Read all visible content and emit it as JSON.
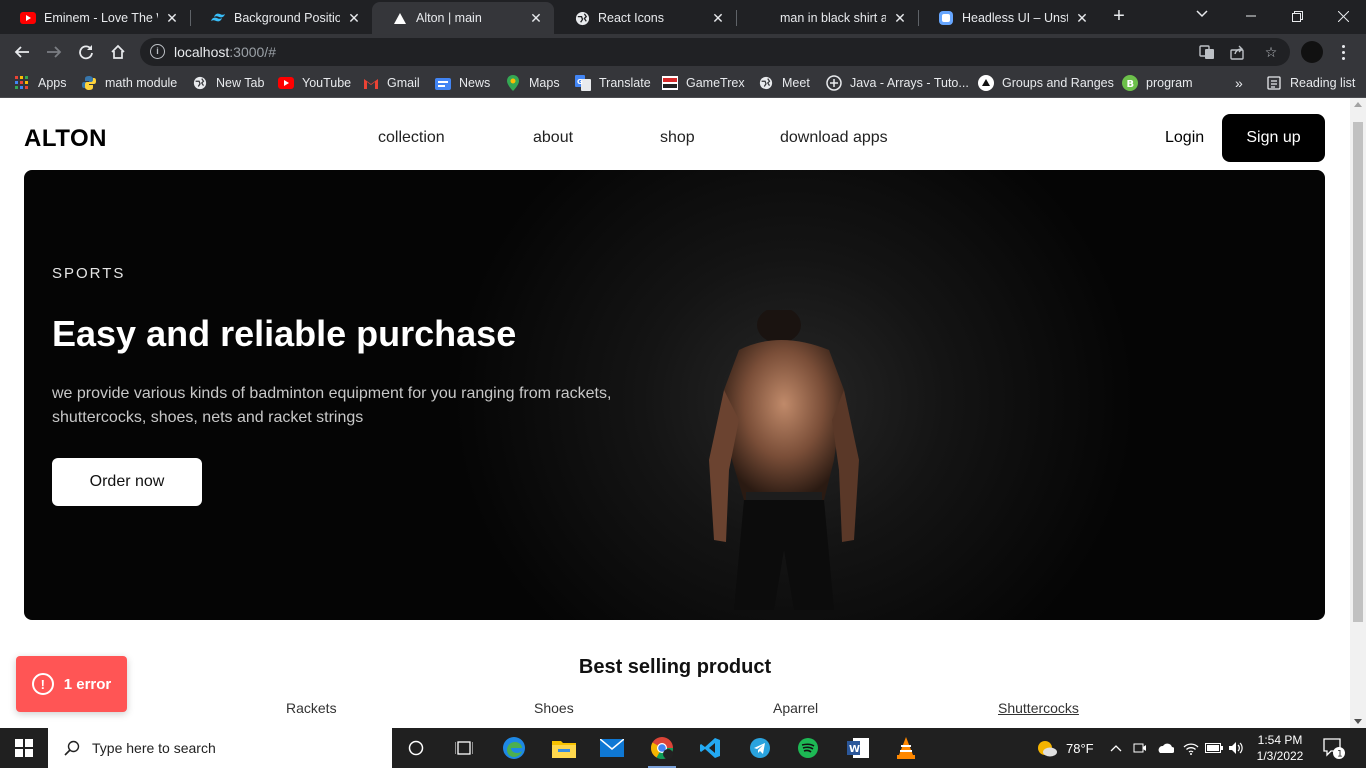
{
  "browser": {
    "tabs": [
      {
        "title": "Eminem - Love The W",
        "icon": "youtube-icon"
      },
      {
        "title": "Background Position -",
        "icon": "tailwind-icon"
      },
      {
        "title": "Alton | main",
        "icon": "vercel-icon",
        "active": true
      },
      {
        "title": "React Icons",
        "icon": "globe-icon"
      },
      {
        "title": "man in black shirt and",
        "icon": "unsplash-icon"
      },
      {
        "title": "Headless UI – Unstyle",
        "icon": "headlessui-icon"
      }
    ],
    "url_host": "localhost",
    "url_rest": ":3000/#",
    "bookmarks": [
      {
        "label": "Apps"
      },
      {
        "label": "math module"
      },
      {
        "label": "New Tab"
      },
      {
        "label": "YouTube"
      },
      {
        "label": "Gmail"
      },
      {
        "label": "News"
      },
      {
        "label": "Maps"
      },
      {
        "label": "Translate"
      },
      {
        "label": "GameTrex"
      },
      {
        "label": "Meet"
      },
      {
        "label": "Java - Arrays - Tuto..."
      },
      {
        "label": "Groups and Ranges"
      },
      {
        "label": "program"
      }
    ],
    "more_bookmarks": "»",
    "reading_list": "Reading list"
  },
  "site": {
    "logo": "ALTON",
    "nav": [
      "collection",
      "about",
      "shop",
      "download apps"
    ],
    "login": "Login",
    "signup": "Sign up",
    "hero": {
      "label": "SPORTS",
      "title": "Easy and reliable purchase",
      "description": "we provide various kinds of badminton equipment for you ranging from rackets, shuttercocks, shoes, nets and racket strings",
      "cta": "Order now"
    },
    "best_selling": {
      "title": "Best selling product",
      "categories": [
        "Rackets",
        "Shoes",
        "Aparrel",
        "Shuttercocks"
      ],
      "active_category": "Shuttercocks"
    },
    "error_toast": "1 error"
  },
  "taskbar": {
    "search_placeholder": "Type here to search",
    "weather": "78°F",
    "time": "1:54 PM",
    "date": "1/3/2022",
    "notification_count": "1"
  },
  "colors": {
    "accent_black": "#000000",
    "error_red": "#ff5555",
    "chrome_dark": "#202124",
    "chrome_toolbar": "#35363a"
  }
}
